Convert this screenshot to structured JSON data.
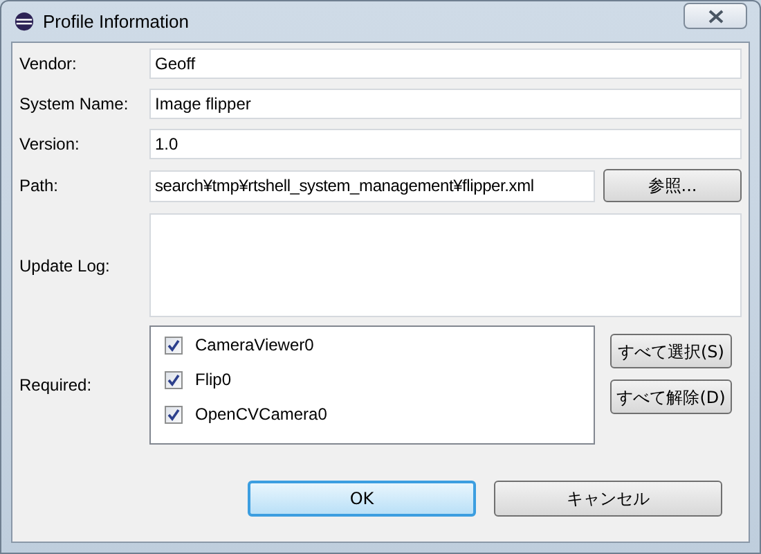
{
  "window": {
    "title": "Profile Information"
  },
  "fields": [
    {
      "label": "Vendor:",
      "value": "Geoff"
    },
    {
      "label": "System Name:",
      "value": "Image flipper"
    },
    {
      "label": "Version:",
      "value": "1.0"
    }
  ],
  "path": {
    "label": "Path:",
    "value": "search¥tmp¥rtshell_system_management¥flipper.xml",
    "button": "参照..."
  },
  "update_log": {
    "label": "Update Log:"
  },
  "required": {
    "label": "Required:",
    "items": [
      {
        "label": "CameraViewer0",
        "checked": true
      },
      {
        "label": "Flip0",
        "checked": true
      },
      {
        "label": "OpenCVCamera0",
        "checked": true
      }
    ],
    "buttons": [
      "すべて選択(S)",
      "すべて解除(D)"
    ]
  },
  "buttons": [
    {
      "label": "OK",
      "selected": true
    },
    {
      "label": "キャンセル",
      "selected": false
    }
  ]
}
